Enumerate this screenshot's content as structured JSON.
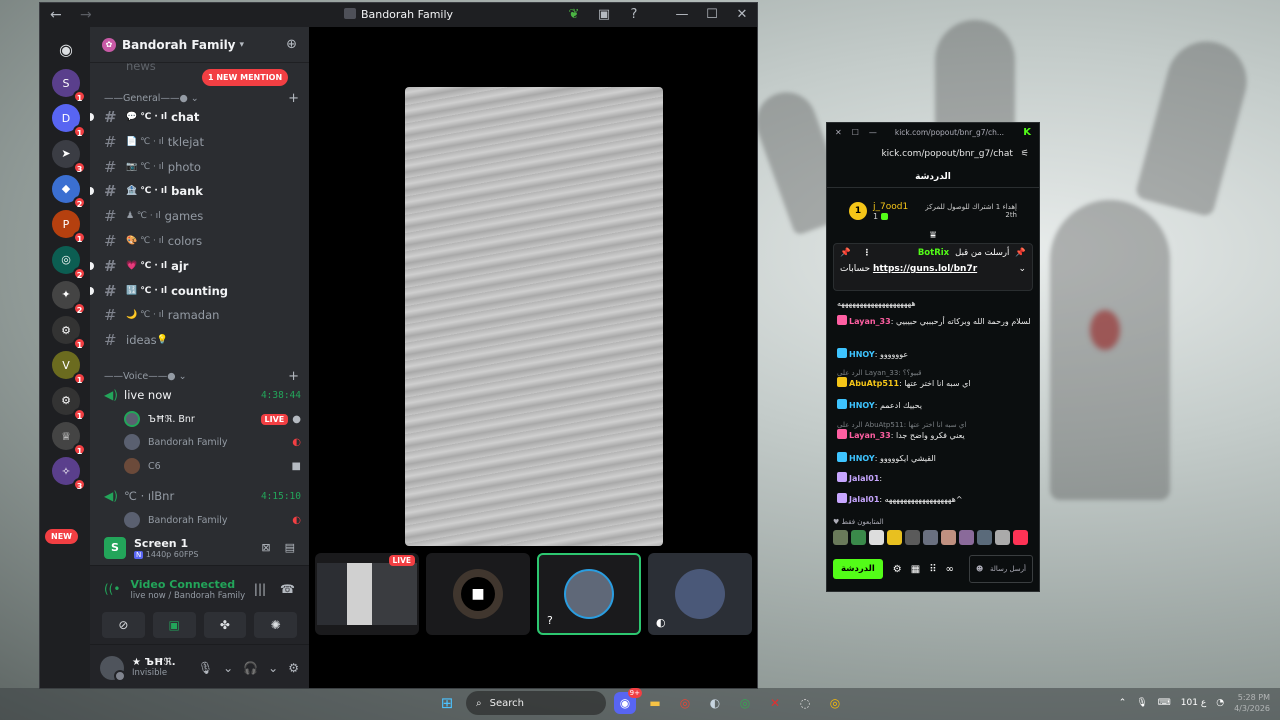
{
  "discord": {
    "title": "Bandorah Family",
    "server_name": "Bandorah Family",
    "mention_pill": "1 NEW MENTION",
    "new_pill": "NEW",
    "servers": [
      {
        "icon": "S",
        "color": "#5a3f8c",
        "badge": "1"
      },
      {
        "icon": "D",
        "color": "#5865f2",
        "badge": "1"
      },
      {
        "icon": "➤",
        "color": "#3b3d44",
        "badge": "3"
      },
      {
        "icon": "◆",
        "color": "#3b6fd1",
        "badge": "2"
      },
      {
        "icon": "P",
        "color": "#b5400f",
        "badge": "1"
      },
      {
        "icon": "◎",
        "color": "#0c5e52",
        "badge": "2"
      },
      {
        "icon": "✦",
        "color": "#444",
        "badge": "2"
      },
      {
        "icon": "⚙",
        "color": "#333",
        "badge": "1"
      },
      {
        "icon": "V",
        "color": "#6b6b1f",
        "badge": "1"
      },
      {
        "icon": "⚙",
        "color": "#333",
        "badge": "1"
      },
      {
        "icon": "♕",
        "color": "#444",
        "badge": "1"
      },
      {
        "icon": "✧",
        "color": "#5a3f8c",
        "badge": "3"
      }
    ],
    "categories": {
      "general": "General",
      "voice": "Voice"
    },
    "channels": [
      {
        "name": "news",
        "unread": false
      },
      {
        "name": "chat",
        "unread": true
      },
      {
        "name": "tklejat",
        "unread": false
      },
      {
        "name": "photo",
        "unread": false
      },
      {
        "name": "bank",
        "unread": true
      },
      {
        "name": "games",
        "unread": false
      },
      {
        "name": "colors",
        "unread": false
      },
      {
        "name": "ajr",
        "unread": true
      },
      {
        "name": "counting",
        "unread": true
      },
      {
        "name": "ramadan",
        "unread": false
      },
      {
        "name": "ideas",
        "unread": false
      }
    ],
    "voice": {
      "live_now": {
        "name": "live now",
        "timer": "4:38:44"
      },
      "users": [
        {
          "name": "ЪĦℜ. Bnr",
          "live": "LIVE"
        },
        {
          "name": "Bandorah Family"
        },
        {
          "name": "C6"
        }
      ],
      "bnr": {
        "name": "Bnr",
        "timer": "4:15:10"
      },
      "bnr_users": [
        {
          "name": "Bandorah Family"
        }
      ]
    },
    "screen": {
      "title": "Screen 1",
      "quality": "1440p 60FPS"
    },
    "vc": {
      "status": "Video Connected",
      "location": "live now / Bandorah Family"
    },
    "user": {
      "name": "★ ЪĦℜ.",
      "status": "Invisible"
    },
    "stage_tiles": [
      {
        "label": "LIVE"
      }
    ]
  },
  "kick": {
    "tab_url": "kick.com/popout/bnr_g7/ch...",
    "url": "kick.com/popout/bnr_g7/chat",
    "tab_title": "الدردشة",
    "leader": {
      "rank": "1",
      "user": "j_7ood1",
      "count": "1",
      "desc": "إهداء 1 اشتراك للوصول للمركز",
      "place": "2th"
    },
    "pinned": {
      "label": "أرسلت من قبل",
      "user": "BotRix",
      "prefix": "حسابات",
      "link": "https://guns.lol/bn7r"
    },
    "messages": [
      {
        "user": "",
        "text": "ههههههههههههههههههههه",
        "color": "#e7e7e7",
        "reply": ""
      },
      {
        "user": "Layan_33",
        "text": "وعليكم السلام ورحمة الله وبركاته أرحبببي حبيبيي",
        "color": "#ff5fa2",
        "reply": ""
      },
      {
        "user": "HNOY",
        "text": "عوووووو",
        "color": "#3ec4ff",
        "reply": ""
      },
      {
        "user": "AbuAtp511",
        "text": "اي سبه انا اختر عتها",
        "color": "#f5c518",
        "reply": "الرد على Layan_33: قبيو؟؟"
      },
      {
        "user": "HNOY",
        "text": "يحييك ادعمم",
        "color": "#3ec4ff",
        "reply": ""
      },
      {
        "user": "Layan_33",
        "text": "يعني فكرو واضح جدا",
        "color": "#ff5fa2",
        "reply": "الرد على AbuAtp511: اي سبه انا اختر عتها"
      },
      {
        "user": "HNOY",
        "text": "القيشي ايكووووو",
        "color": "#3ec4ff",
        "reply": ""
      },
      {
        "user": "Jalal01",
        "text": "",
        "color": "#c7a6ff",
        "reply": ""
      },
      {
        "user": "Jalal01",
        "text": "ههههههههههههههههههه^",
        "color": "#c7a6ff",
        "reply": ""
      }
    ],
    "fans_title": "المتابعون فقط",
    "chat_button": "الدردشة",
    "input_placeholder": "أرسل رسالة"
  },
  "taskbar": {
    "search": "Search",
    "discord_badge": "9+",
    "clock_time": "5:28 PM",
    "clock_date": "4/3/2026",
    "lang": "ع 101"
  }
}
